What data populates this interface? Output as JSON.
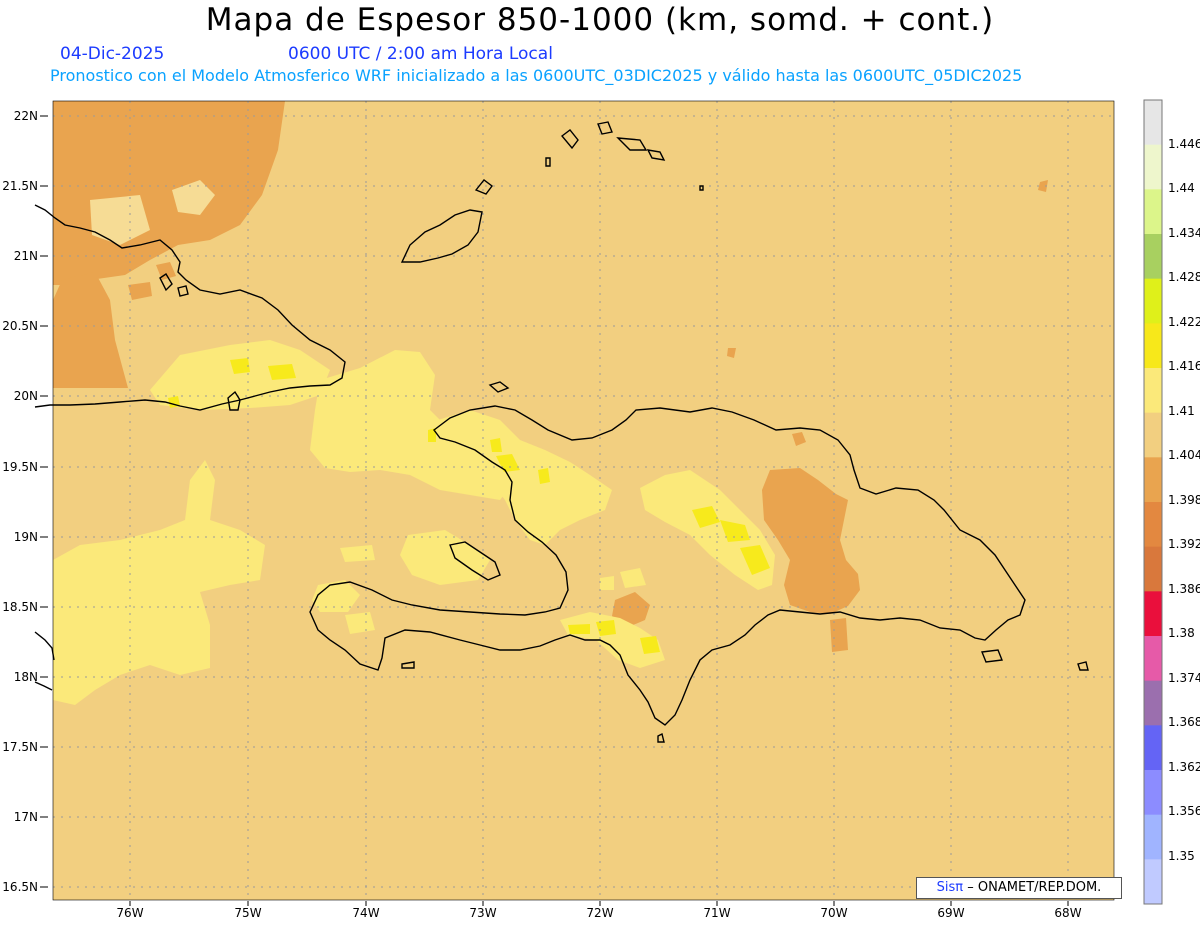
{
  "header": {
    "title": "Mapa de Espesor 850-1000 (km, somd. + cont.)",
    "date": "04-Dic-2025",
    "time": "0600 UTC / 2:00 am Hora Local",
    "forecast": "Pronostico con el Modelo Atmosferico WRF inicializado a las 0600UTC_03DIC2025 y válido hasta las  0600UTC_05DIC2025"
  },
  "map": {
    "lat_labels": [
      "22N",
      "21.5N",
      "21N",
      "20.5N",
      "20N",
      "19.5N",
      "19N",
      "18.5N",
      "18N",
      "17.5N",
      "17N",
      "16.5N"
    ],
    "lon_labels": [
      "76W",
      "75W",
      "74W",
      "73W",
      "72W",
      "71W",
      "70W",
      "69W",
      "68W"
    ],
    "colors": {
      "background": "#f2cf80",
      "band_1398": "#e9a44f",
      "band_1404": "#f5e3a0",
      "band_1410": "#fbe97a",
      "band_1416": "#f7ea1c"
    }
  },
  "colorbar": {
    "labels": [
      "1.446",
      "1.44",
      "1.434",
      "1.428",
      "1.422",
      "1.416",
      "1.41",
      "1.404",
      "1.398",
      "1.392",
      "1.386",
      "1.38",
      "1.374",
      "1.368",
      "1.362",
      "1.356",
      "1.35"
    ],
    "colors": [
      "#e6e6e6",
      "#eef6cc",
      "#dcf58a",
      "#a8d060",
      "#dff01a",
      "#f7e81a",
      "#fbe97a",
      "#f2cf80",
      "#e9a44f",
      "#e38840",
      "#d9783c",
      "#ea0f3c",
      "#e65aa8",
      "#9b6fae",
      "#6464f5",
      "#8c8cff",
      "#a0b4ff",
      "#c0caff"
    ]
  },
  "credit": {
    "brand": "Sisπ",
    "text": "– ONAMET/REP.DOM."
  }
}
